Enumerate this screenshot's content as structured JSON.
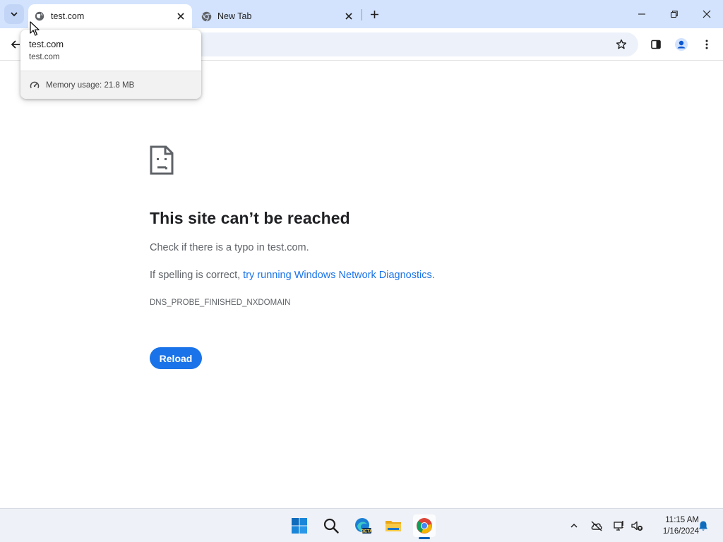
{
  "browser": {
    "tabs": [
      {
        "title": "test.com",
        "active": true,
        "favicon": "globe-icon"
      },
      {
        "title": "New Tab",
        "active": false,
        "favicon": "chrome-icon"
      }
    ],
    "hover_card": {
      "title": "test.com",
      "domain": "test.com",
      "memory": "Memory usage: 21.8 MB"
    }
  },
  "error_page": {
    "heading": "This site can’t be reached",
    "line1": "Check if there is a typo in test.com.",
    "line2_prefix": "If spelling is correct, ",
    "line2_link": "try running Windows Network Diagnostics",
    "line2_suffix": ".",
    "error_code": "DNS_PROBE_FINISHED_NXDOMAIN",
    "reload_label": "Reload"
  },
  "taskbar": {
    "apps": [
      "windows-start-icon",
      "search-icon",
      "edge-beta-icon",
      "file-explorer-icon",
      "chrome-icon"
    ],
    "active_app": "chrome-icon",
    "clock": {
      "time": "11:15 AM",
      "date": "1/16/2024"
    }
  },
  "colors": {
    "tabstrip": "#d3e3fd",
    "omnibox": "#edf2fa",
    "link": "#1a73e8",
    "reload_button": "#1a73e8"
  }
}
